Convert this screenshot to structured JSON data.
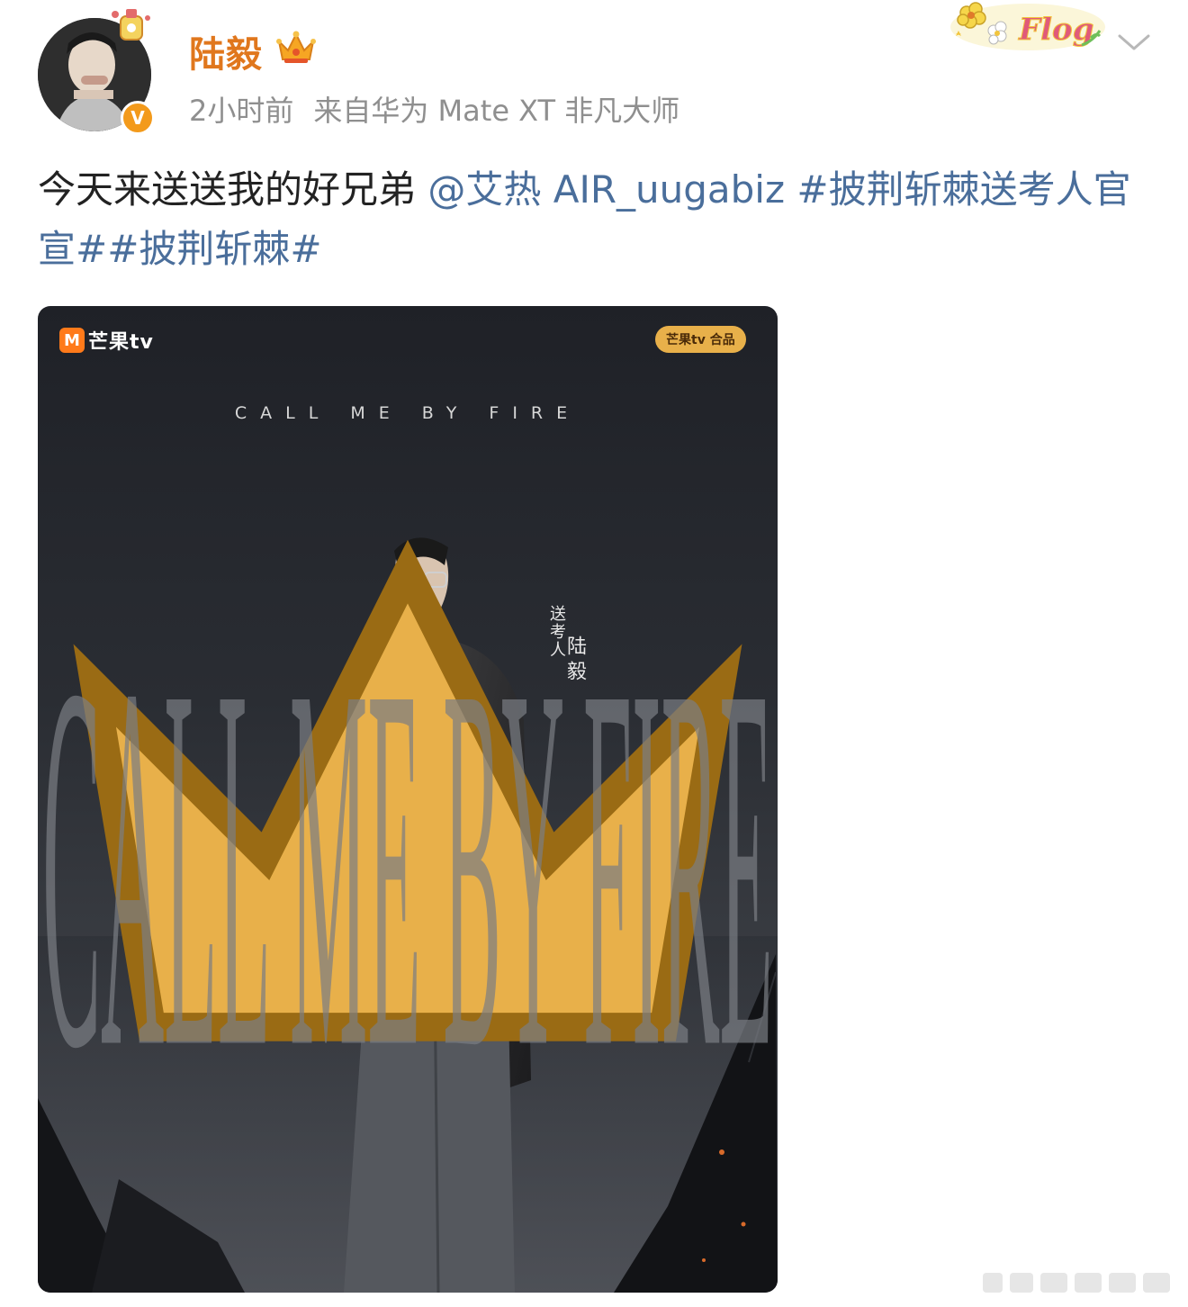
{
  "post": {
    "username": "陆毅",
    "timestamp": "2小时前",
    "source": "来自华为 Mate XT 非凡大师",
    "text_plain": "今天来送送我的好兄弟 ",
    "mention": "@艾热 AIR_uugabiz",
    "hashtag_1": " #披荆斩棘送考人官宣#",
    "hashtag_2": "#披荆斩棘#",
    "badge_text": "Flog",
    "verified_mark": "V"
  },
  "poster": {
    "logo_mark": "M",
    "logo_text": "芒果tv",
    "partner_badge": "芒果tv 合品",
    "tagline": "CALL ME BY FIRE",
    "big_title": "CALL ME BY FIRE",
    "role": "送考人",
    "name": "陆毅"
  },
  "colors": {
    "username": "#e0771d",
    "link": "#4a6e9b",
    "meta": "#8f8f8f",
    "verified": "#f39a1b"
  },
  "icons": [
    "crown-icon",
    "chevron-down-icon",
    "verified-icon",
    "flog-badge"
  ]
}
